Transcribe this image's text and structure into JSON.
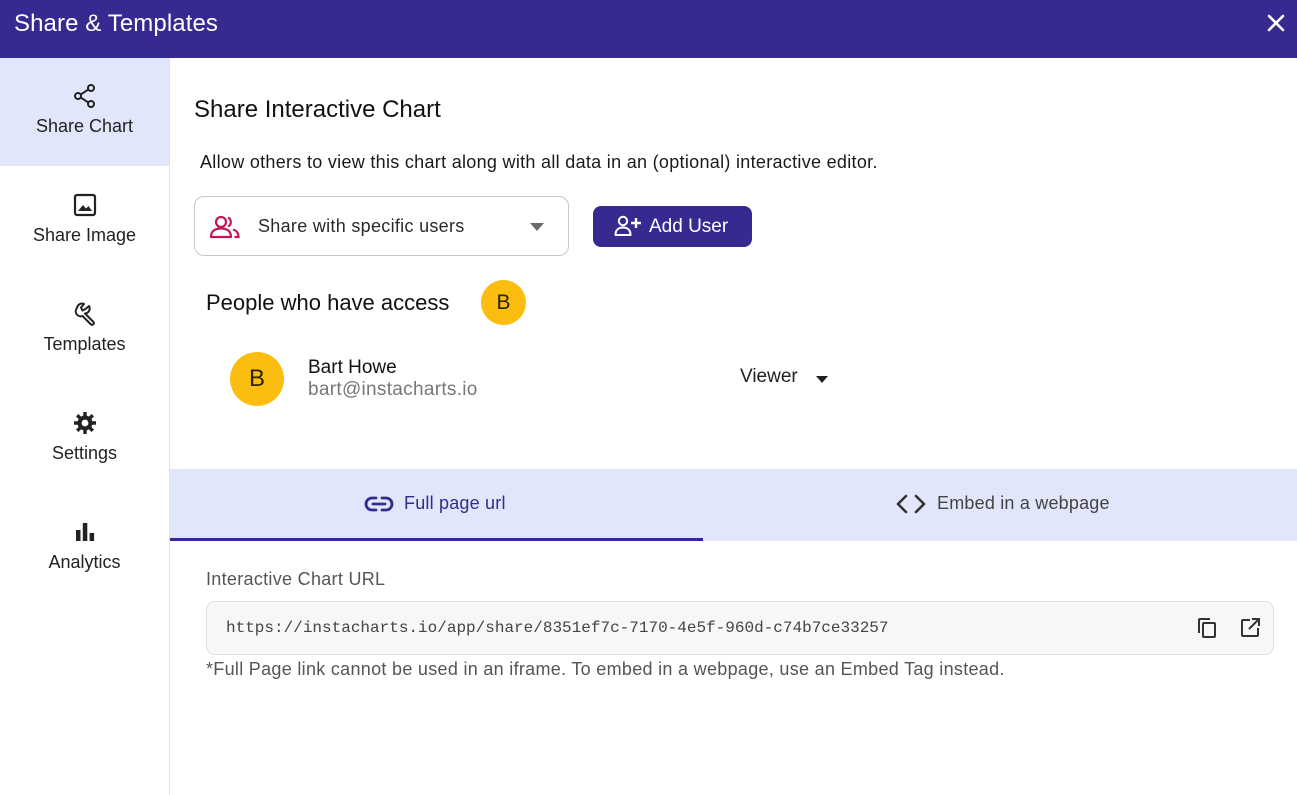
{
  "window": {
    "title": "Share & Templates",
    "close_icon": "close-icon"
  },
  "sidebar": {
    "items": [
      {
        "label": "Share Chart",
        "icon": "share-icon",
        "active": true
      },
      {
        "label": "Share Image",
        "icon": "image-icon",
        "active": false
      },
      {
        "label": "Templates",
        "icon": "wrench-icon",
        "active": false
      },
      {
        "label": "Settings",
        "icon": "gear-icon",
        "active": false
      },
      {
        "label": "Analytics",
        "icon": "bar-chart-icon",
        "active": false
      }
    ]
  },
  "main": {
    "heading": "Share Interactive Chart",
    "description": "Allow others to view this chart along with all data in an (optional) interactive editor.",
    "share_select": {
      "value": "Share with specific users",
      "icon": "users-icon"
    },
    "add_user_label": "Add User",
    "access": {
      "title": "People who have access",
      "avatar_letter": "B",
      "users": [
        {
          "initial": "B",
          "name": "Bart Howe",
          "email": "bart@instacharts.io",
          "role": "Viewer"
        }
      ]
    },
    "tabs": [
      {
        "label": "Full page url",
        "icon": "link-icon",
        "active": true
      },
      {
        "label": "Embed in a webpage",
        "icon": "code-icon",
        "active": false
      }
    ],
    "url_label": "Interactive Chart URL",
    "url": "https://instacharts.io/app/share/8351ef7c-7170-4e5f-960d-c74b7ce33257",
    "note": "*Full Page link cannot be used in an iframe. To embed in a webpage, use an Embed Tag instead."
  },
  "colors": {
    "brand": "#362a90",
    "active_bg": "#e1e6fb",
    "avatar": "#fbbd10",
    "users_icon": "#c2185b"
  }
}
